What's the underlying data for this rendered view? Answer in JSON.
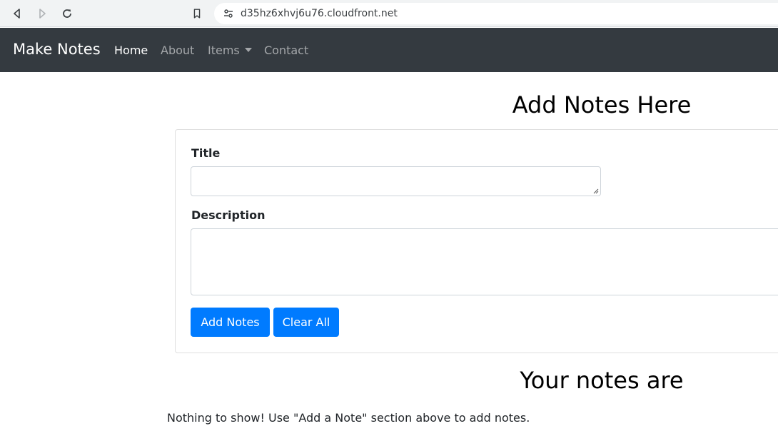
{
  "browser": {
    "url": "d35hz6xhvj6u76.cloudfront.net"
  },
  "navbar": {
    "brand": "Make Notes",
    "links": [
      {
        "label": "Home",
        "active": true
      },
      {
        "label": "About",
        "active": false
      },
      {
        "label": "Items",
        "active": false,
        "dropdown": true
      },
      {
        "label": "Contact",
        "active": false
      }
    ]
  },
  "form": {
    "heading": "Add Notes Here",
    "title_label": "Title",
    "title_value": "",
    "description_label": "Description",
    "description_value": "",
    "add_button": "Add Notes",
    "clear_button": "Clear All"
  },
  "notes": {
    "heading": "Your notes are",
    "empty_message": "Nothing to show! Use \"Add a Note\" section above to add notes."
  },
  "colors": {
    "navbar_bg": "#343a40",
    "primary_button": "#007bff"
  }
}
